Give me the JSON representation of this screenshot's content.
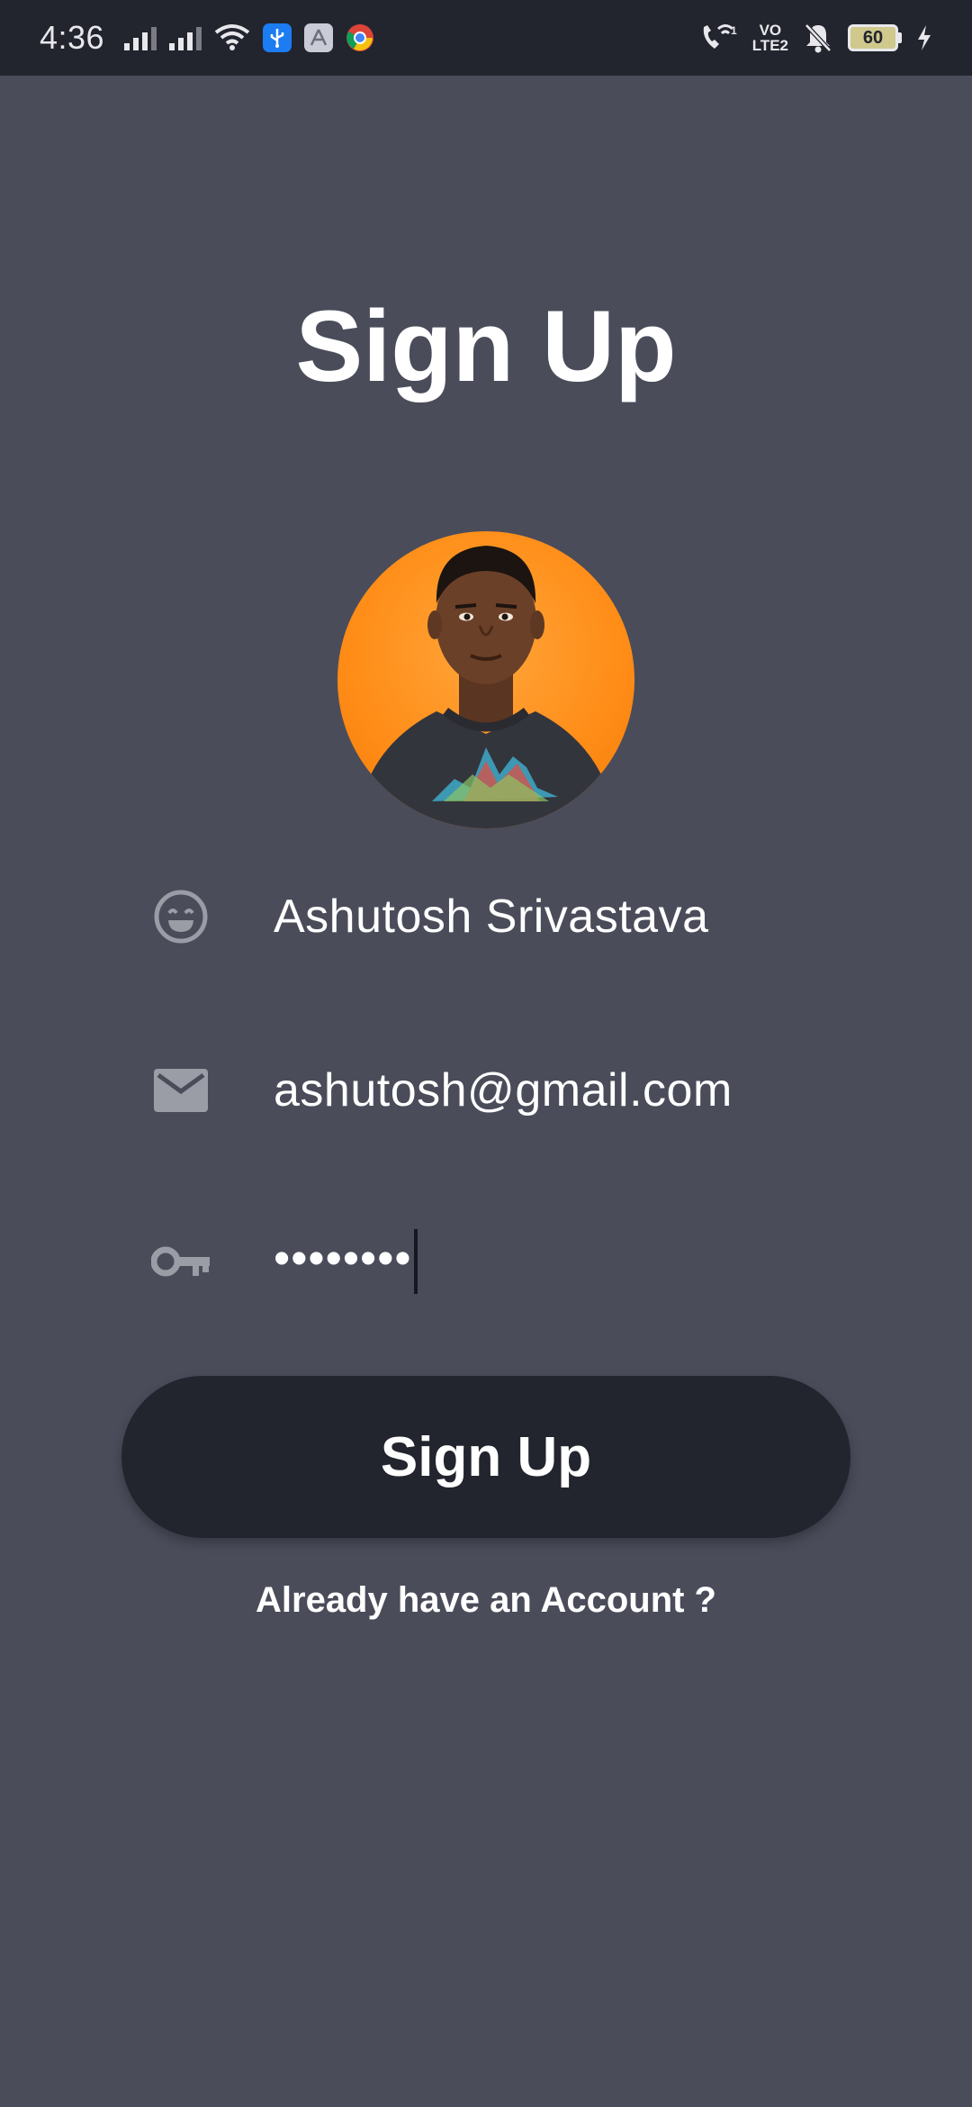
{
  "status_bar": {
    "time": "4:36",
    "battery_level": "60",
    "network_label_top": "VO",
    "network_label_bottom": "LTE2",
    "icons": [
      "signal-icon",
      "signal-icon",
      "wifi-icon",
      "usb-icon",
      "app-icon",
      "chrome-icon",
      "wifi-calling-icon",
      "mute-icon",
      "battery-icon",
      "charging-icon"
    ]
  },
  "screen": {
    "title": "Sign Up",
    "avatar_icon": "profile-photo",
    "fields": {
      "name": {
        "icon": "smiley-icon",
        "value": "Ashutosh Srivastava"
      },
      "email": {
        "icon": "mail-icon",
        "value": "ashutosh@gmail.com"
      },
      "password": {
        "icon": "key-icon",
        "value": "••••••••"
      }
    },
    "submit_label": "Sign Up",
    "login_link": "Already have an Account ?"
  },
  "colors": {
    "background": "#4a4c5a",
    "status_bar": "#22242e",
    "button": "#22242e",
    "text": "#ffffff",
    "icon": "#9a9ca6",
    "avatar_bg": "#ff8c16"
  }
}
